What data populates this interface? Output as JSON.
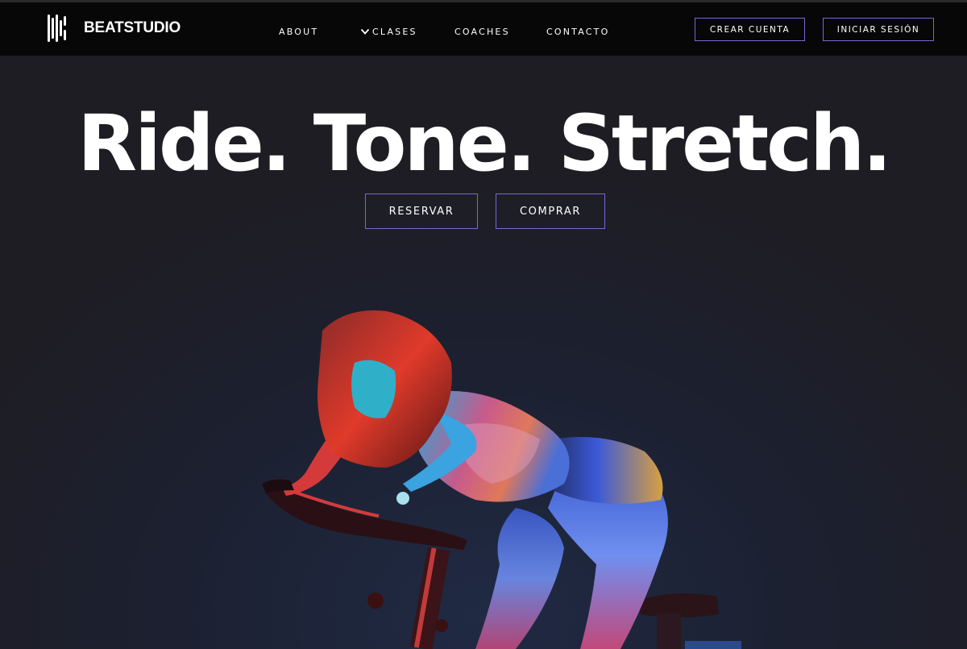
{
  "brand": {
    "name": "BEATSTUDIO",
    "logo_icon": "beat-bars-logo"
  },
  "nav": {
    "items": [
      {
        "label": "ABOUT"
      },
      {
        "label": "CLASES",
        "icon": "chevron-down-icon"
      },
      {
        "label": "COACHES"
      },
      {
        "label": "CONTACTO"
      }
    ]
  },
  "account": {
    "create_label": "CREAR CUENTA",
    "login_label": "INICIAR SESIÓN"
  },
  "hero": {
    "headline": "Ride. Tone. Stretch.",
    "reserve_label": "RESERVAR",
    "buy_label": "COMPRAR"
  },
  "colors": {
    "topbar": "#070707",
    "background": "#1e1d24",
    "accent_border": "#7867d6",
    "text": "#ffffff"
  }
}
